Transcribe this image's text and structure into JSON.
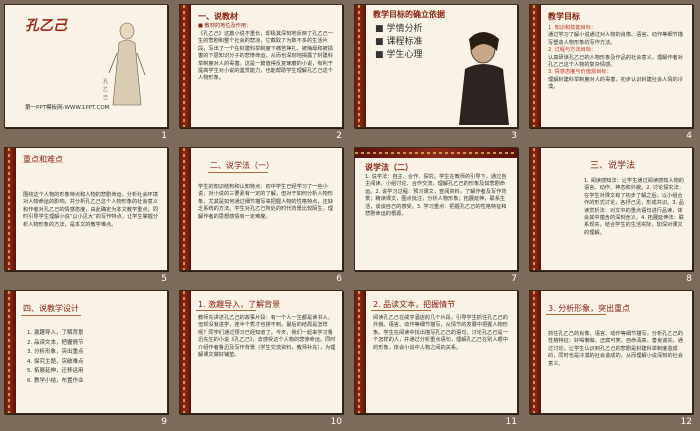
{
  "slides": [
    {
      "num": "1",
      "title": "孔乙己",
      "url": "第一PPT模板网-WWW.1PPT.COM"
    },
    {
      "num": "2",
      "title": "一、说教材",
      "sub": "■ 教材的地位及作用：",
      "body": "《孔乙己》这篇小说不重长，却极其深刻地反映了孔乙己一生的悲剧和整个社会的悲凉，它截取了为数不多的生活片段，写出了一个在封建科举制度下痛苦挣扎、被侮辱和被损害的下层知识分子的悲惨命运，从而也深刻地揭露了封建科举制度对人的毒害。这是一篇值得反复琢磨的小说，有利于提高学生对小说的鉴赏能力，也能帮助学生理解孔乙己这个人物形象。"
    },
    {
      "num": "3",
      "title": "教学目标的确立依据",
      "items": [
        "学情分析",
        "课程标准",
        "学生心理"
      ]
    },
    {
      "num": "4",
      "title": "教学目标",
      "sections": [
        "1. 知识和技能目标：",
        "通过学习了解小说通过对人物的肖像、语言、动作等细节描写塑造人物形象的写作方法。",
        "2. 过程与方法目标：",
        "认真研读孔乙己的人物形象及作品的社会意义，理解作者对孔乙己这个人物的复杂情感。",
        "3. 情感态度与价值观目标：",
        "理解封建科举制度对人的毒害，初步认识封建社会人情的冷漠。"
      ]
    },
    {
      "num": "5",
      "title": "重点和难点",
      "body": "围绕这个人物的形象特点和人物的悲剧命运，分析社会环境对人物命运的影响，并分析孔乙己这个人物形象的社会意义和作者对孔乙己的情感态度，由此确定为本文教学重点；同时引导学生理解小说“以小见大”的写作特点，让学生掌握分析人物形象的方法，是本文的教学难点。"
    },
    {
      "num": "6",
      "title": "二、说学法（一）",
      "body": "学生的知识结构和认知特点：初中学生已经学习了一些小说，对小说的三要素有一定的了解，但对于如何分析人物形象，尤其是如何通过细节描写来把握人物的性格特点，还缺乏系统的方法。学生对孔乙己所处的时代背景比较陌生，理解作者的思想感情有一定难度。"
    },
    {
      "num": "7",
      "title": "说学法（二）",
      "body": "1. 说学法：自主、合作、探究。学生在教师的引导下，通过自主阅读、小组讨论、合作交流，理解孔乙己的形象及其悲剧命运。2. 说学习过程：预习课文，查阅资料，了解作者及写作背景；精读课文，圈点批注，分析人物形象；拓展延伸，联系生活，谈谈自己的感受。3. 学习重点：把握孔乙己的性格特征和悲剧命运的根源。"
    },
    {
      "num": "8",
      "title": "三、说学法",
      "body": "1. 阅读感知法：让学生通过阅读感知人物的语言、动作、神态和外貌。2. 讨论探究法：在学生对课文有了初步了解之后，以小组合作的形式讨论，各抒己见，形成共识。3. 品读赏析法：对文中的重点语句进行品读，体会其中蕴含的深刻含义。4. 拓展延伸法：联系现实，结合学生的生活实际，加深对课文的理解。"
    },
    {
      "num": "9",
      "title": "四、说教学设计",
      "items": [
        "1. 激趣导入，了解背景",
        "2. 品读文本，把握情节",
        "3. 分析形象，突出重点",
        "4. 探究主题，突破难点",
        "5. 拓展延伸，迁移运用",
        "6. 教学小结，布置作业"
      ]
    },
    {
      "num": "10",
      "title": "1. 激趣导入，了解背景",
      "body": "教师先讲述孔乙己的故事片段：有一个人一生都是读书人，但却没有进学，连半个秀才也捞不到。最后的结局是怎样呢？同学们通过预习已经知道了。今天，我们一起来学习鲁迅先生的小说《孔乙己》，去感受这个人物的悲惨命运。同时介绍作者鲁迅及写作背景（学生交流资料，教师补充），为理解课文做好铺垫。"
    },
    {
      "num": "11",
      "title": "2. 品读文本，把握情节",
      "body": "阅读孔乙己在咸亨酒店的几个片段，引导学生抓住孔乙己的外貌、语言、动作等细节描写，从情节的发展中把握人物形象。学生在阅读中找出描写孔乙己的语句，讨论孔乙己是一个怎样的人，并通过分析重点语句，理解孔乙己在别人眼中的形象，体会小说中人物之间的关系。"
    },
    {
      "num": "12",
      "title": "3. 分析形象，突出重点",
      "body": "抓住孔乙己的肖像、语言、动作等细节描写，分析孔乙己的性格特征：好喝懒做、迂腐可笑、自命清高、善良诚实。通过讨论，让学生认识到孔乙己的悲剧是封建科举制度造成的，同时也是冷漠的社会造成的，从而理解小说深刻的社会意义。"
    }
  ]
}
